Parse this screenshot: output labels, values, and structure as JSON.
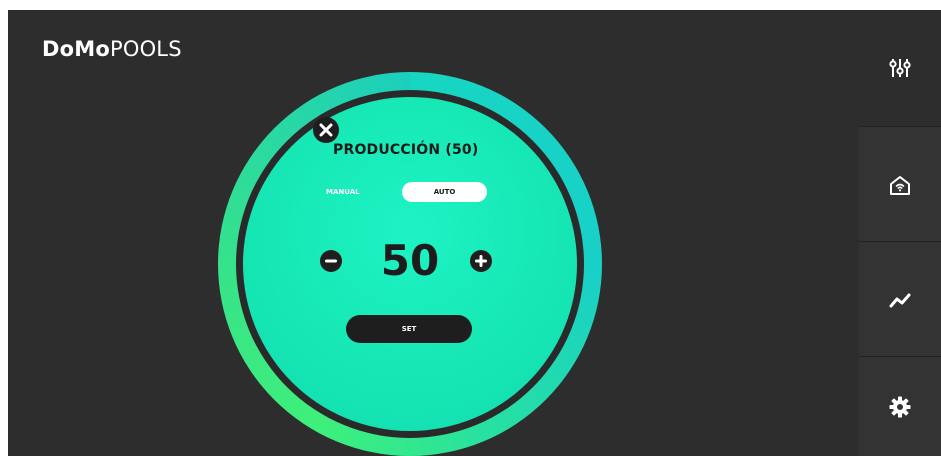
{
  "app": {
    "brand_bold": "DoMo",
    "brand_light": "POOLS"
  },
  "nav": {
    "items": [
      {
        "icon": "sliders-icon"
      },
      {
        "icon": "home-wifi-icon"
      },
      {
        "icon": "trend-chart-icon"
      },
      {
        "icon": "gear-icon"
      }
    ]
  },
  "dialog": {
    "title": "PRODUCCIÓN (50)",
    "mode_manual": "MANUAL",
    "mode_auto": "AUTO",
    "selected_mode": "AUTO",
    "value": "50",
    "set_label": "SET"
  },
  "colors": {
    "background": "#2d2d2d",
    "accent": "#16e7b4",
    "ring_green": "#3ef07a",
    "ring_teal": "#17d6c2",
    "dark": "#1e1e1e"
  }
}
